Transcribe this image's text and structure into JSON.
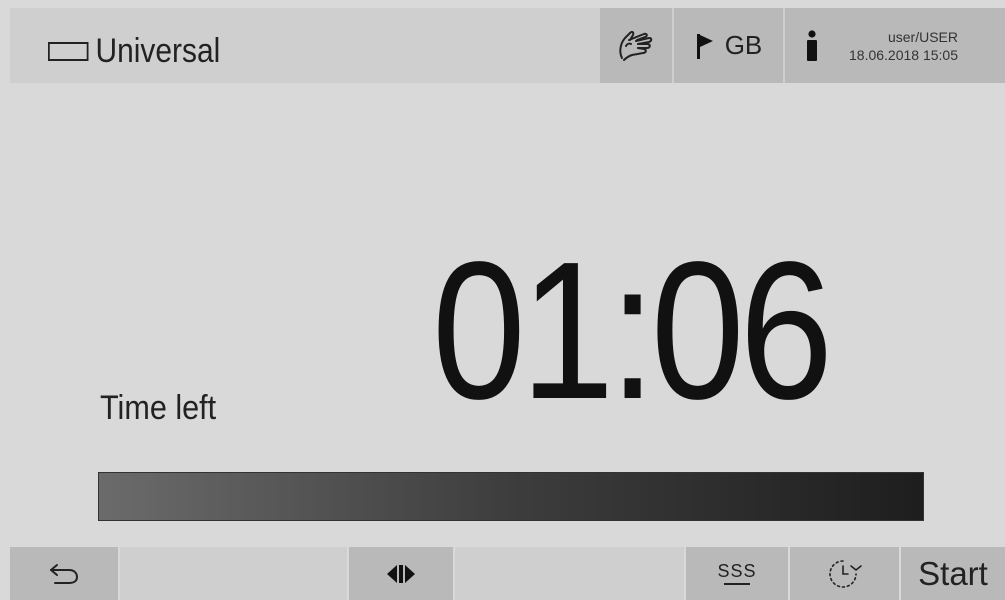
{
  "header": {
    "program_icon": "program-rectangle-icon",
    "program_name": "Universal",
    "manual_icon": "hand-touch-icon",
    "language_icon": "flag-icon",
    "language_code": "GB",
    "user_icon": "person-icon",
    "user_name": "user/USER",
    "datetime": "18.06.2018 15:05"
  },
  "main": {
    "time_left_label": "Time left",
    "timer_value": "01:06",
    "progress_percent": 100
  },
  "footer": {
    "back_icon": "back-arrow-icon",
    "door_icon": "door-open-close-icon",
    "drying_icon": "drying-heat-icon",
    "drying_symbol": "SSS",
    "delay_icon": "delayed-start-clock-icon",
    "start_label": "Start"
  },
  "colors": {
    "background": "#d9d9d9",
    "header_bg": "#cfcfcf",
    "button_bg": "#b9b9b9",
    "progress_dark": "#1e1e1e",
    "progress_light": "#6b6b6b"
  }
}
